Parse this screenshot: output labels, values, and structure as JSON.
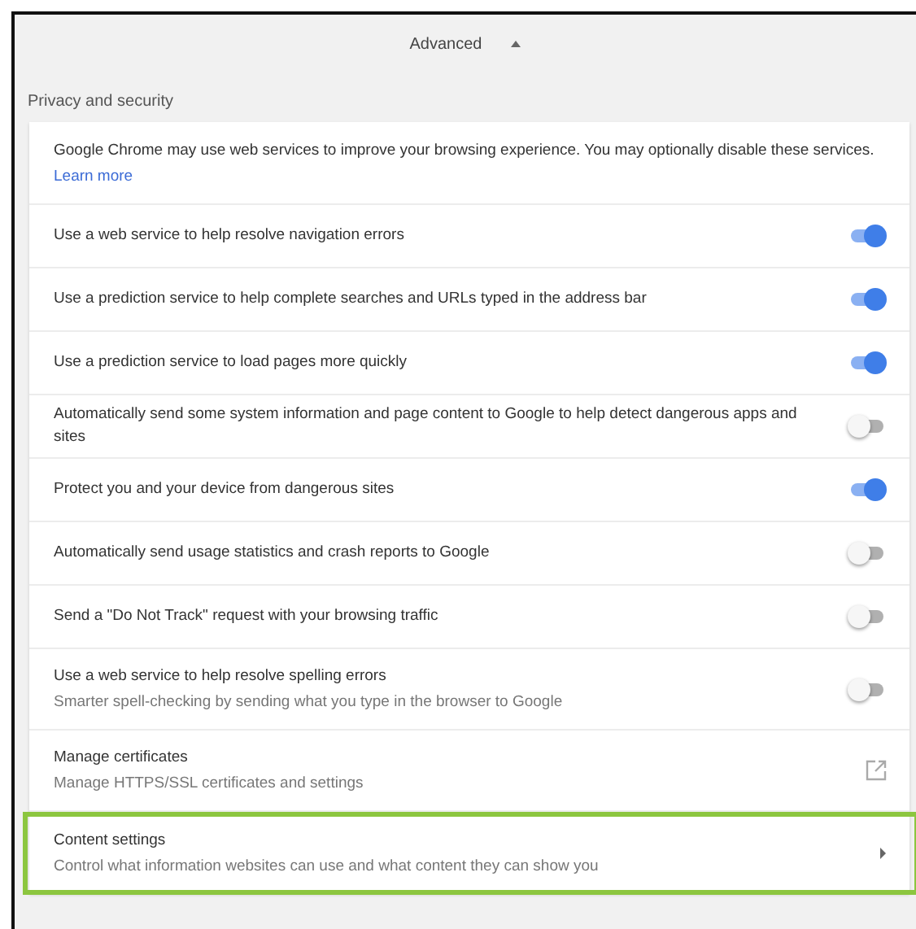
{
  "advanced": {
    "label": "Advanced",
    "expanded": true
  },
  "section_title": "Privacy and security",
  "intro": {
    "text": "Google Chrome may use web services to improve your browsing experience. You may optionally disable these services.",
    "link": "Learn more"
  },
  "rows": [
    {
      "kind": "toggle",
      "label": "Use a web service to help resolve navigation errors",
      "on": true
    },
    {
      "kind": "toggle",
      "label": "Use a prediction service to help complete searches and URLs typed in the address bar",
      "on": true
    },
    {
      "kind": "toggle",
      "label": "Use a prediction service to load pages more quickly",
      "on": true
    },
    {
      "kind": "toggle",
      "label": "Automatically send some system information and page content to Google to help detect dangerous apps and sites",
      "on": false
    },
    {
      "kind": "toggle",
      "label": "Protect you and your device from dangerous sites",
      "on": true
    },
    {
      "kind": "toggle",
      "label": "Automatically send usage statistics and crash reports to Google",
      "on": false
    },
    {
      "kind": "toggle",
      "label": "Send a \"Do Not Track\" request with your browsing traffic",
      "on": false
    },
    {
      "kind": "toggle",
      "label": "Use a web service to help resolve spelling errors",
      "sublabel": "Smarter spell-checking by sending what you type in the browser to Google",
      "on": false
    },
    {
      "kind": "external",
      "label": "Manage certificates",
      "sublabel": "Manage HTTPS/SSL certificates and settings",
      "highlighted": false
    },
    {
      "kind": "subpage",
      "label": "Content settings",
      "sublabel": "Control what information websites can use and what content they can show you",
      "highlighted": true
    }
  ]
}
